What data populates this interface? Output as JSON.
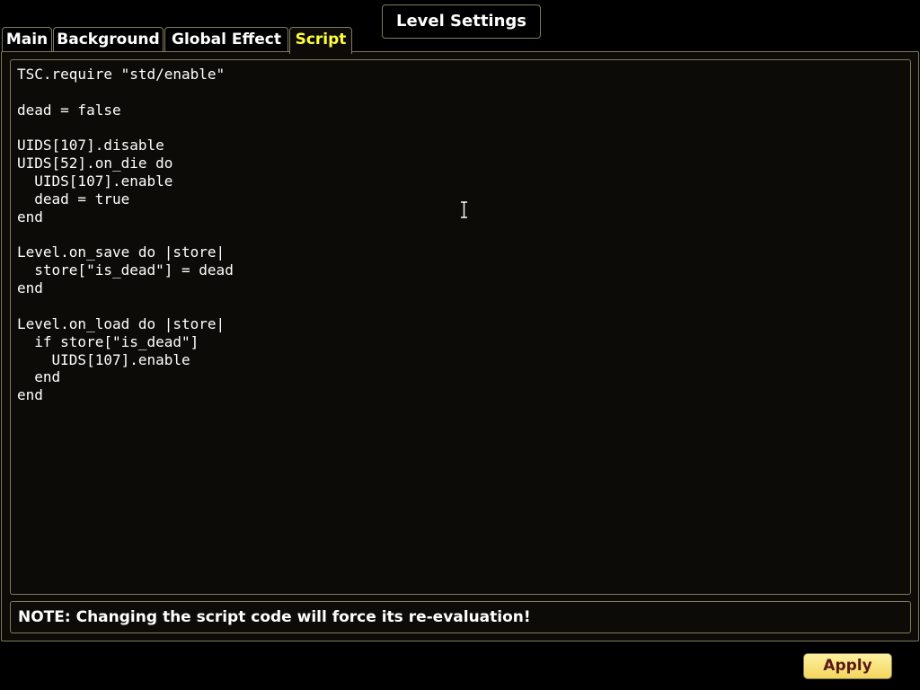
{
  "window": {
    "title": "Level Settings"
  },
  "tabs": [
    {
      "label": "Main",
      "active": false
    },
    {
      "label": "Background",
      "active": false
    },
    {
      "label": "Global Effect",
      "active": false
    },
    {
      "label": "Script",
      "active": true
    }
  ],
  "script": {
    "code": "TSC.require \"std/enable\"\n\ndead = false\n\nUIDS[107].disable\nUIDS[52].on_die do\n  UIDS[107].enable\n  dead = true\nend\n\nLevel.on_save do |store|\n  store[\"is_dead\"] = dead\nend\n\nLevel.on_load do |store|\n  if store[\"is_dead\"]\n    UIDS[107].enable\n  end\nend"
  },
  "note": {
    "text": "NOTE: Changing the script code will force its re-evaluation!"
  },
  "buttons": {
    "apply_label": "Apply"
  },
  "colors": {
    "active_tab_text": "#ffff3c",
    "border": "#7f7a5a",
    "apply_bg": "#f6dc6a",
    "apply_text": "#5a1a14"
  },
  "icons": {
    "cursor": "text-ibeam-cursor-icon"
  }
}
